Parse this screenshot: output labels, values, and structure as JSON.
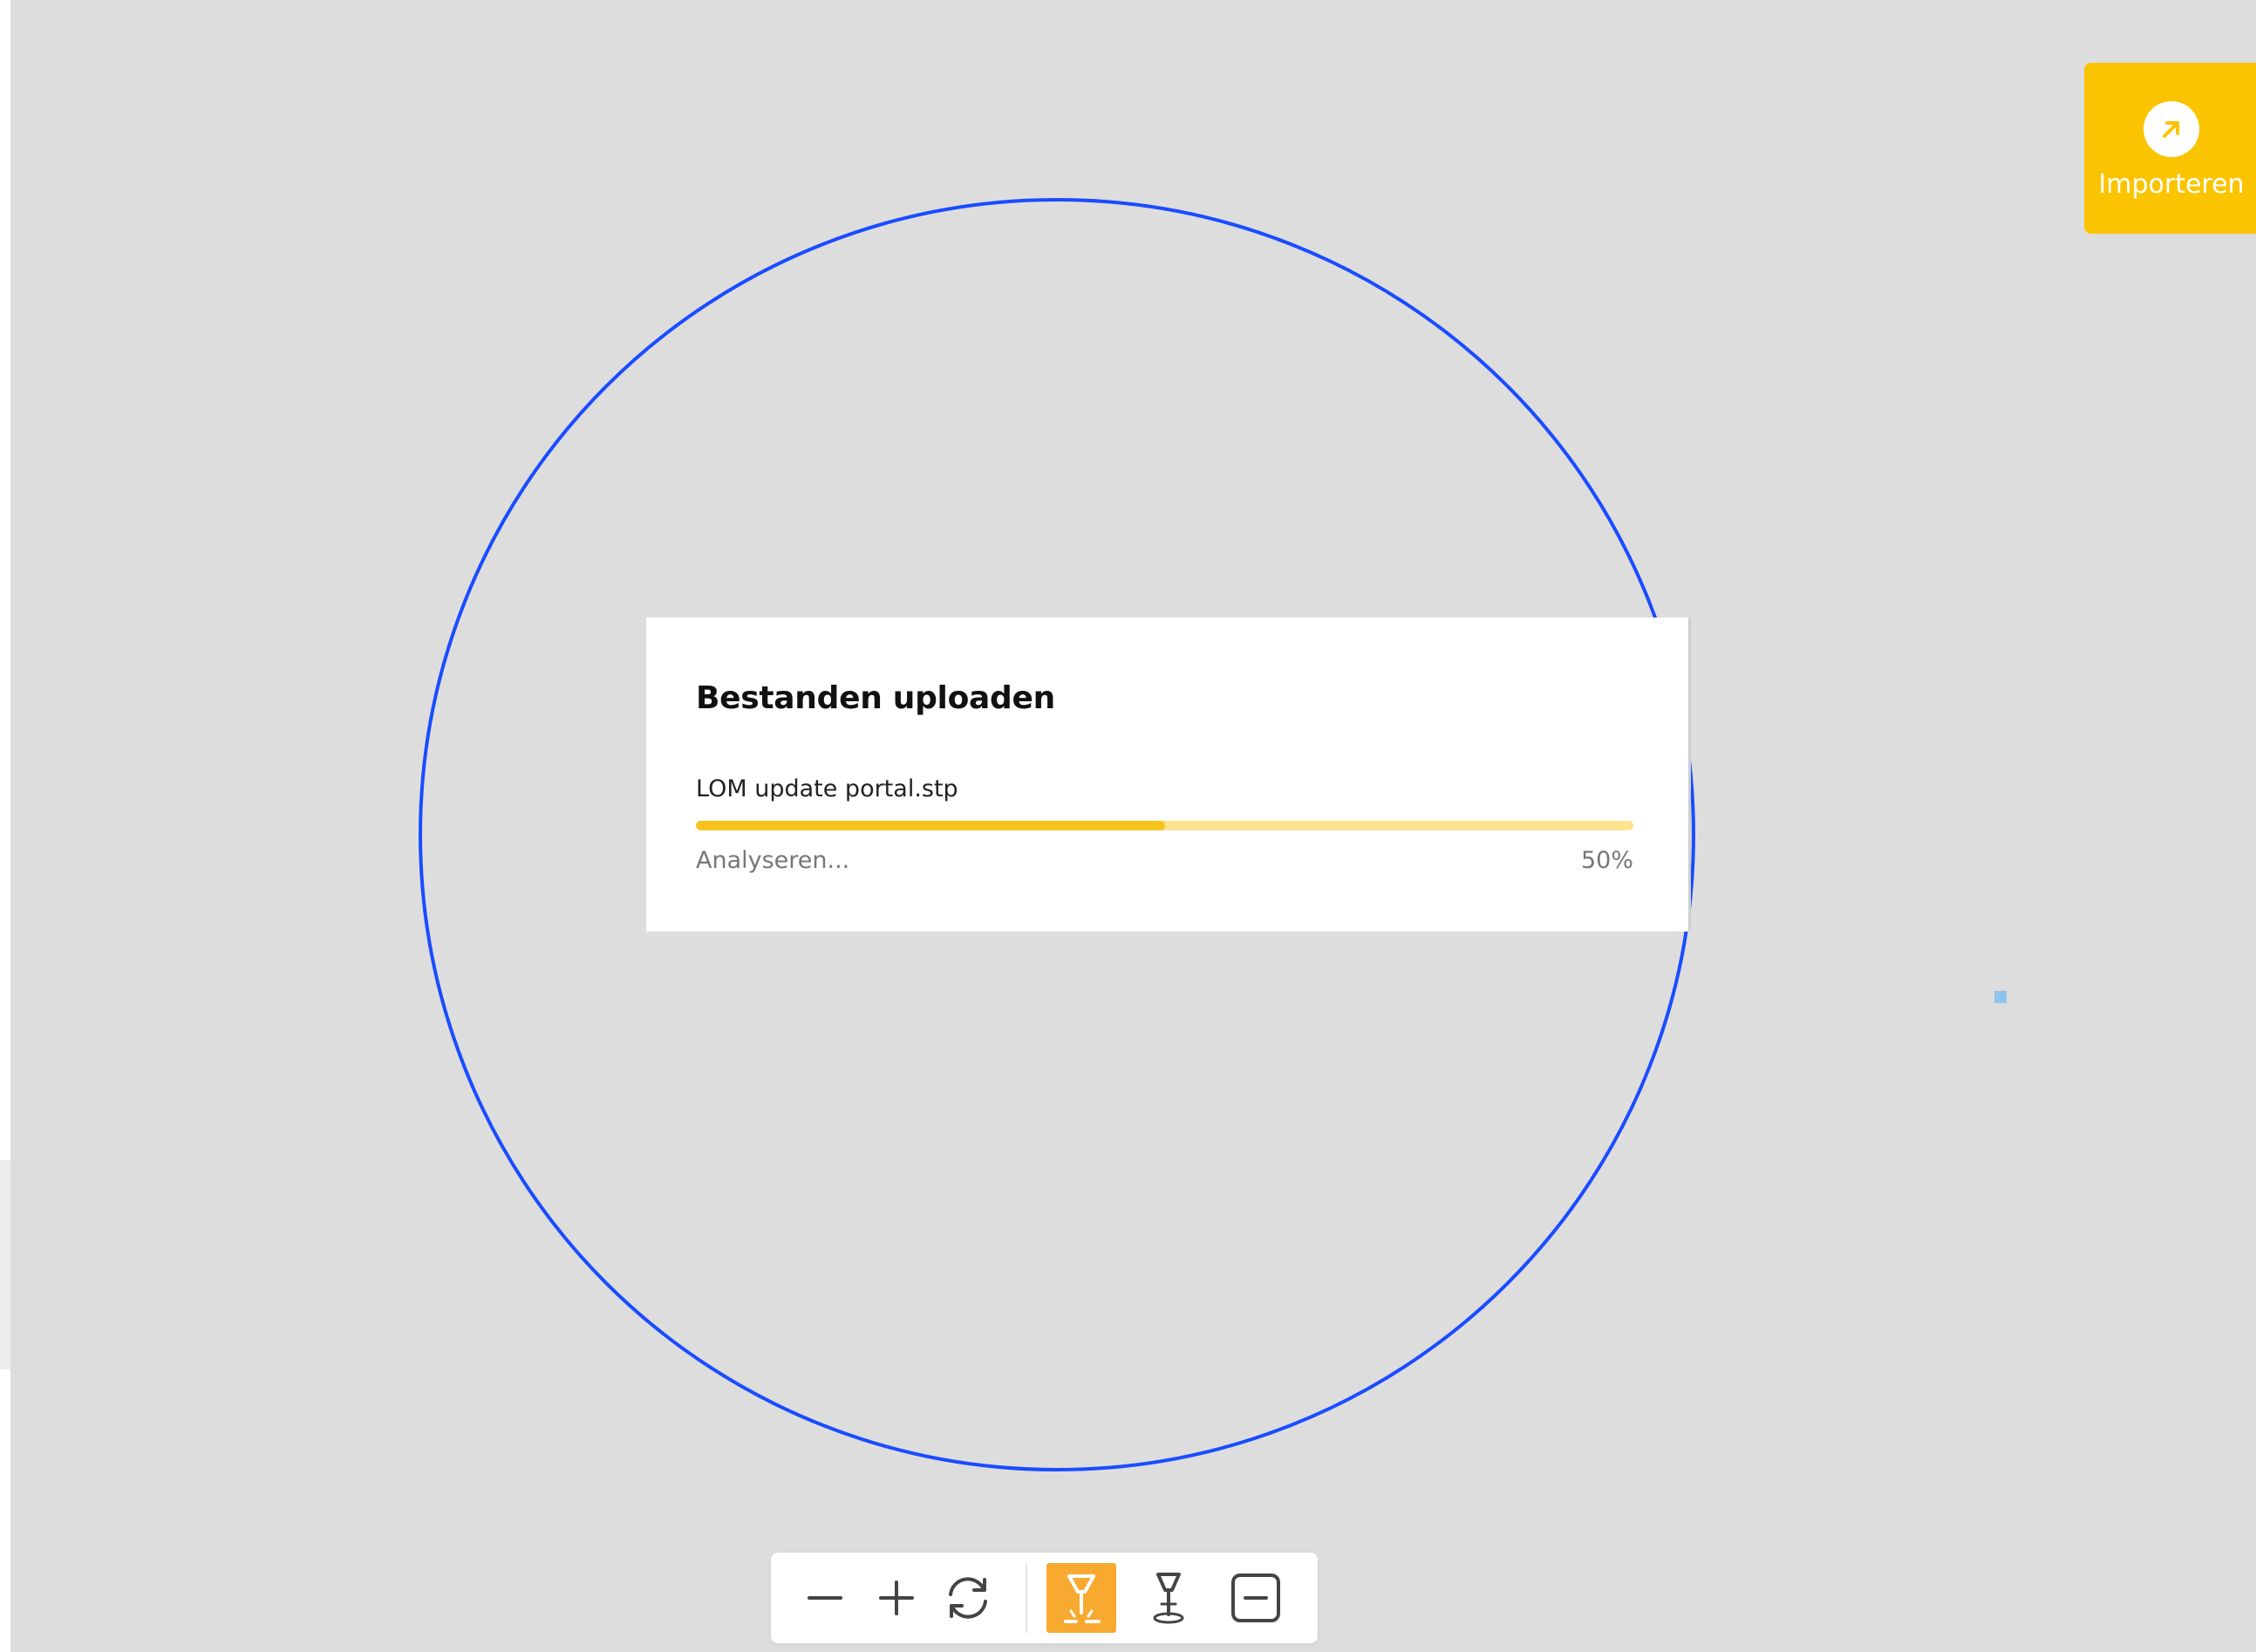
{
  "import_button": {
    "label": "Importeren",
    "icon": "arrow-up-right-icon",
    "color": "#fbc400"
  },
  "upload_dialog": {
    "title": "Bestanden uploaden",
    "file_name": "LOM update portal.stp",
    "status": "Analyseren...",
    "percent_label": "50%",
    "progress": 0.5,
    "progress_color": "#f8c21c",
    "track_color": "#fde28f"
  },
  "viewport": {
    "background": "#dddddd",
    "outline_color": "#1a4cff"
  },
  "toolbar": {
    "buttons": [
      {
        "name": "zoom-out",
        "icon": "minus-icon",
        "active": false
      },
      {
        "name": "zoom-in",
        "icon": "plus-icon",
        "active": false
      },
      {
        "name": "rotate",
        "icon": "rotate-icon",
        "active": false
      },
      {
        "name": "laser-cut",
        "icon": "laser-cut-icon",
        "active": true
      },
      {
        "name": "laser-engrave",
        "icon": "laser-engrave-icon",
        "active": false
      },
      {
        "name": "remove",
        "icon": "minus-square-icon",
        "active": false
      }
    ],
    "active_color": "#f8a930"
  }
}
